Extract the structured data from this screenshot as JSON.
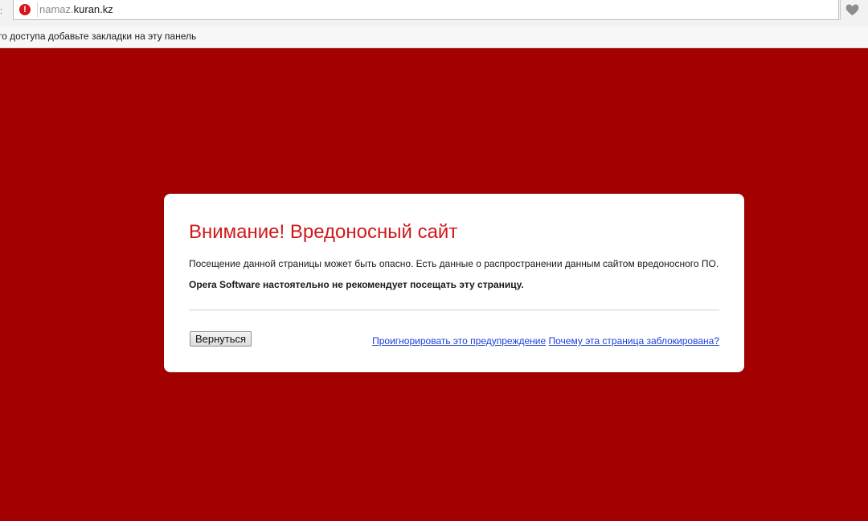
{
  "browser": {
    "menu_glyph": ":",
    "address_bar": {
      "warning_symbol": "!",
      "url_subdomain": "namaz.",
      "url_host": "kuran.kz"
    },
    "heart_icon": "heart-icon",
    "bookmarks_bar": {
      "hint_text": "го доступа добавьте закладки на эту панель"
    }
  },
  "colors": {
    "page_background": "#a30000",
    "title": "#d0191b",
    "link": "#1b3fd6",
    "warning_icon": "#d7131b"
  },
  "warning": {
    "title": "Внимание! Вредоносный сайт",
    "description": "Посещение данной страницы может быть опасно. Есть данные о распространении данным сайтом вредоносного ПО.",
    "recommendation": "Opera Software настоятельно не рекомендует посещать эту страницу.",
    "back_button": "Вернуться",
    "ignore_link": "Проигнорировать это предупреждение",
    "why_blocked_link": "Почему эта страница заблокирована?"
  }
}
